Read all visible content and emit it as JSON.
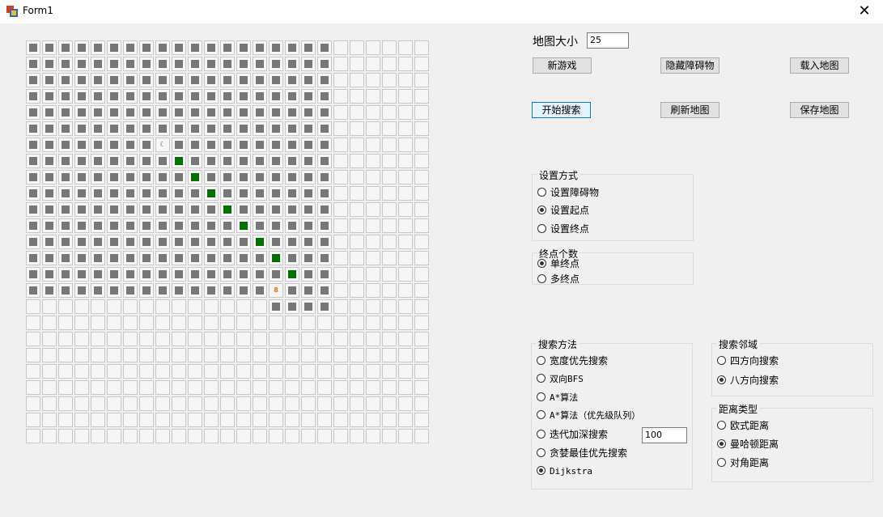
{
  "window": {
    "title": "Form1",
    "close_glyph": "✕"
  },
  "map": {
    "size": 25,
    "start_marker": "☾",
    "end_marker": "8",
    "start_cell": [
      6,
      8
    ],
    "end_cell": [
      15,
      15
    ],
    "path_cells": [
      [
        7,
        9
      ],
      [
        8,
        10
      ],
      [
        9,
        11
      ],
      [
        10,
        12
      ],
      [
        11,
        13
      ],
      [
        12,
        14
      ],
      [
        13,
        15
      ],
      [
        14,
        16
      ]
    ],
    "obstacle_rows": 16,
    "obstacle_cols": 19,
    "extra_obstacles": [
      [
        16,
        15
      ],
      [
        16,
        16
      ],
      [
        16,
        17
      ],
      [
        16,
        18
      ]
    ]
  },
  "controls": {
    "map_size_label": "地图大小",
    "map_size_value": "25",
    "new_game": "新游戏",
    "hide_obstacles": "隐藏障碍物",
    "load_map": "载入地图",
    "start_search": "开始搜索",
    "refresh_map": "刷新地图",
    "save_map": "保存地图"
  },
  "setup_mode": {
    "title": "设置方式",
    "options": [
      "设置障碍物",
      "设置起点",
      "设置终点"
    ],
    "selected": 1
  },
  "end_count": {
    "title": "终点个数",
    "options": [
      "单终点",
      "多终点"
    ],
    "selected": 0
  },
  "search_method": {
    "title": "搜索方法",
    "options": [
      "宽度优先搜索",
      "双向BFS",
      "A*算法",
      "A*算法（优先级队列）",
      "迭代加深搜索",
      "贪婪最佳优先搜索",
      "Dijkstra"
    ],
    "selected": 6,
    "depth_value": "100"
  },
  "neighborhood": {
    "title": "搜索邻域",
    "options": [
      "四方向搜索",
      "八方向搜索"
    ],
    "selected": 1
  },
  "distance": {
    "title": "距离类型",
    "options": [
      "欧式距离",
      "曼哈顿距离",
      "对角距离"
    ],
    "selected": 1
  }
}
